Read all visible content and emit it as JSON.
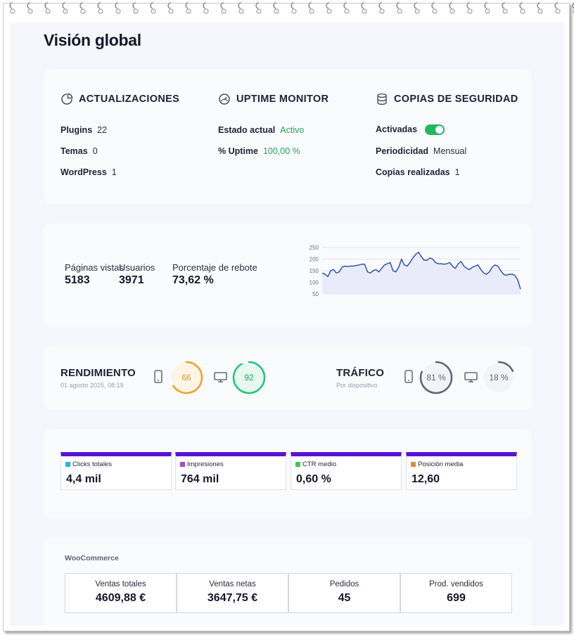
{
  "page": {
    "title": "Visión global"
  },
  "summary": {
    "updates": {
      "title": "ACTUALIZACIONES",
      "icon": "pie-chart-icon",
      "rows": [
        {
          "label": "Plugins",
          "value": "22"
        },
        {
          "label": "Temas",
          "value": "0"
        },
        {
          "label": "WordPress",
          "value": "1"
        }
      ]
    },
    "uptime": {
      "title": "UPTIME MONITOR",
      "icon": "speedometer-icon",
      "rows": [
        {
          "label": "Estado actual",
          "value": "Activo"
        },
        {
          "label": "% Uptime",
          "value": "100,00 %"
        }
      ]
    },
    "backups": {
      "title": "COPIAS DE SEGURIDAD",
      "icon": "database-icon",
      "rows": [
        {
          "label": "Activadas",
          "value": "on"
        },
        {
          "label": "Periodicidad",
          "value": "Mensual"
        },
        {
          "label": "Copias realizadas",
          "value": "1"
        }
      ]
    }
  },
  "analytics": {
    "page_views": {
      "label": "Páginas vistas",
      "value": "5183"
    },
    "users": {
      "label": "Usuarios",
      "value": "3971"
    },
    "bounce": {
      "label": "Porcentaje de rebote",
      "value": "73,62 %"
    }
  },
  "chart_data": {
    "type": "area",
    "title": "",
    "xlabel": "",
    "ylabel": "",
    "y_ticks": [
      "250",
      "200",
      "150",
      "100",
      "50"
    ],
    "ylim": [
      50,
      250
    ],
    "grid": true,
    "color": "#2f56b0",
    "fill": "#e9ebfa",
    "values": [
      140,
      135,
      125,
      150,
      155,
      140,
      145,
      165,
      170,
      168,
      170,
      170,
      172,
      175,
      178,
      178,
      145,
      140,
      150,
      155,
      145,
      160,
      175,
      180,
      185,
      150,
      145,
      165,
      200,
      175,
      170,
      185,
      205,
      220,
      230,
      210,
      195,
      195,
      205,
      200,
      185,
      180,
      180,
      178,
      180,
      185,
      170,
      160,
      180,
      190,
      170,
      160,
      155,
      165,
      170,
      175,
      155,
      140,
      135,
      145,
      165,
      175,
      170,
      150,
      135,
      130,
      135,
      135,
      130,
      110,
      70
    ]
  },
  "performance": {
    "title": "RENDIMIENTO",
    "date": "01 agosto 2025, 08:19",
    "mobile": {
      "icon": "mobile-icon",
      "score": "66",
      "value": 66,
      "color": "#f0a12b",
      "bg": "#fff5e6",
      "text_color": "#e6941c"
    },
    "desktop": {
      "icon": "desktop-icon",
      "score": "92",
      "value": 92,
      "color": "#22c77a",
      "bg": "#e6f8ef",
      "text_color": "#14a85f"
    }
  },
  "traffic": {
    "title": "TRÁFICO",
    "subtitle": "Por dispositivo",
    "mobile": {
      "icon": "mobile-icon",
      "label": "81 %",
      "value": 81,
      "color": "#5f6377"
    },
    "desktop": {
      "icon": "desktop-icon",
      "label": "18 %",
      "value": 18,
      "color": "#5f6377"
    }
  },
  "search": {
    "kpis": [
      {
        "label": "Clicks totales",
        "value": "4,4 mil",
        "color": "#2ab3e0"
      },
      {
        "label": "Impresiones",
        "value": "764 mil",
        "color": "#b145c9"
      },
      {
        "label": "CTR medio",
        "value": "0,60 %",
        "color": "#46c25a"
      },
      {
        "label": "Posición media",
        "value": "12,60",
        "color": "#e8892a"
      }
    ]
  },
  "woocommerce": {
    "title": "WooCommerce",
    "stats": [
      {
        "label": "Ventas totales",
        "value": "4609,88 €"
      },
      {
        "label": "Ventas netas",
        "value": "3647,75 €"
      },
      {
        "label": "Pedidos",
        "value": "45"
      },
      {
        "label": "Prod. vendidos",
        "value": "699"
      }
    ]
  }
}
